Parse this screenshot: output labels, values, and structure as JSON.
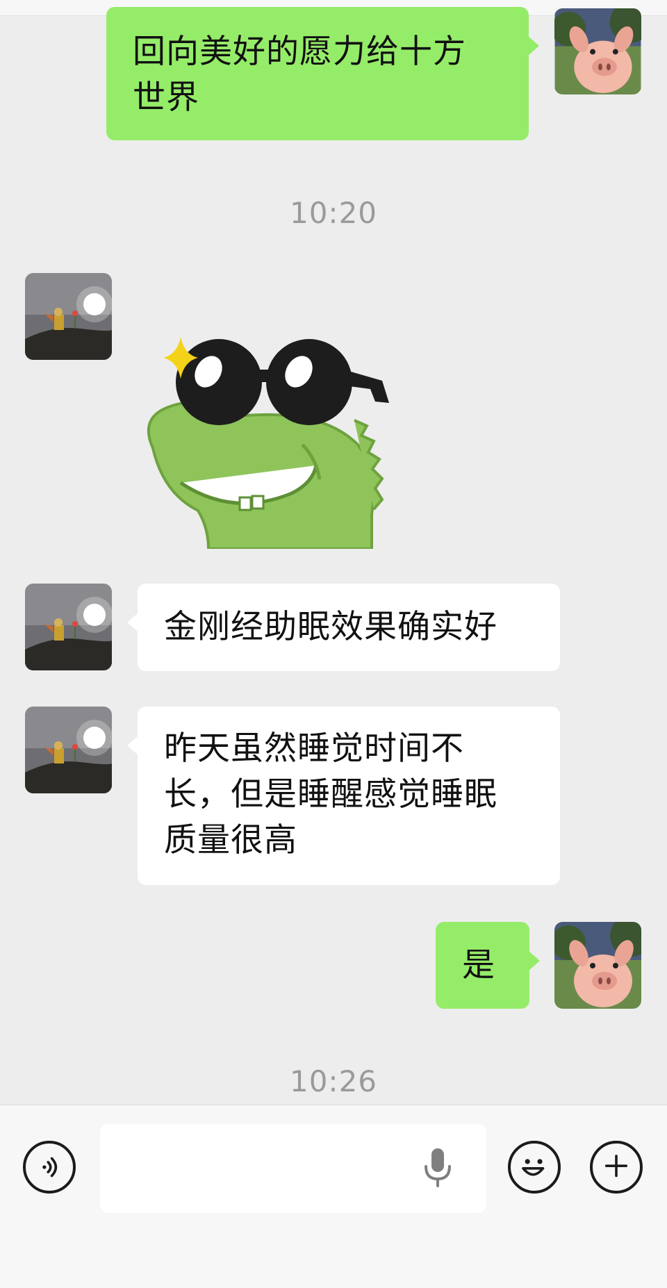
{
  "messages": [
    {
      "sender": "me",
      "text": "回向美好的愿力给十方世界",
      "lines": [
        "回向美好的愿力给十方",
        "世界"
      ]
    },
    {
      "timestamp": "10:20"
    },
    {
      "sender": "other",
      "type": "sticker",
      "sticker": "green-dinosaur-sunglasses-sticker"
    },
    {
      "sender": "other",
      "text": "金刚经助眠效果确实好"
    },
    {
      "sender": "other",
      "text": "昨天虽然睡觉时间不长，但是睡醒感觉睡眠质量很高",
      "lines": [
        "昨天虽然睡觉时间不",
        "长，但是睡醒感觉睡眠",
        "质量很高"
      ]
    },
    {
      "sender": "me",
      "text": "是"
    },
    {
      "timestamp": "10:26"
    }
  ],
  "input_bar": {
    "placeholder": "",
    "voice_icon": "voice-icon",
    "mic_icon": "microphone-icon",
    "emoji_icon": "emoji-icon",
    "plus_icon": "plus-icon"
  },
  "colors": {
    "background": "#ededed",
    "outgoing_bubble": "#95ec69",
    "incoming_bubble": "#ffffff",
    "timestamp_text": "#9a9a9a"
  }
}
